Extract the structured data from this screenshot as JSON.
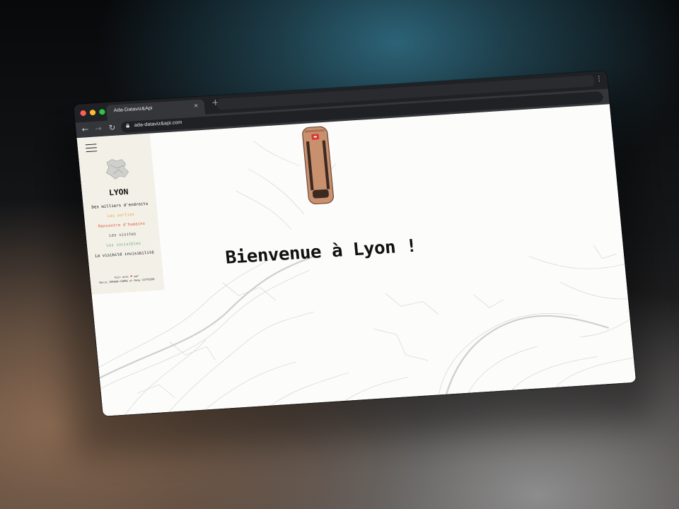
{
  "browser": {
    "tab_title": "Ada-Dataviz&Api",
    "tab_close": "×",
    "new_tab": "+",
    "menu": "⋮",
    "nav_back": "←",
    "nav_forward": "→",
    "nav_reload": "↻",
    "url": "ada-dataviz&api.com"
  },
  "sidebar": {
    "city": "LYON",
    "items": [
      {
        "label": "Des milliers d'endroits",
        "color": "#111111"
      },
      {
        "label": "Les sorties",
        "color": "#f2a33a"
      },
      {
        "label": "Rencontre d'humains",
        "color": "#e45d3a"
      },
      {
        "label": "Les visites",
        "color": "#4a4a4a"
      },
      {
        "label": "Les invisibles",
        "color": "#6fb38a"
      },
      {
        "label": "La visibité invisibilité",
        "color": "#111111"
      }
    ],
    "footer_line1": "Fait avec",
    "footer_heart": "❤",
    "footer_line1b": "par",
    "footer_line2": "Marie JORDAN-CARRE et Remy CATTOIRE"
  },
  "main": {
    "welcome": "Bienvenue à Lyon !"
  },
  "colors": {
    "bus_body": "#c9906e",
    "bus_badge": "#d93434",
    "sidebar_bg": "#f3f0e8",
    "page_bg": "#fcfcfb"
  }
}
